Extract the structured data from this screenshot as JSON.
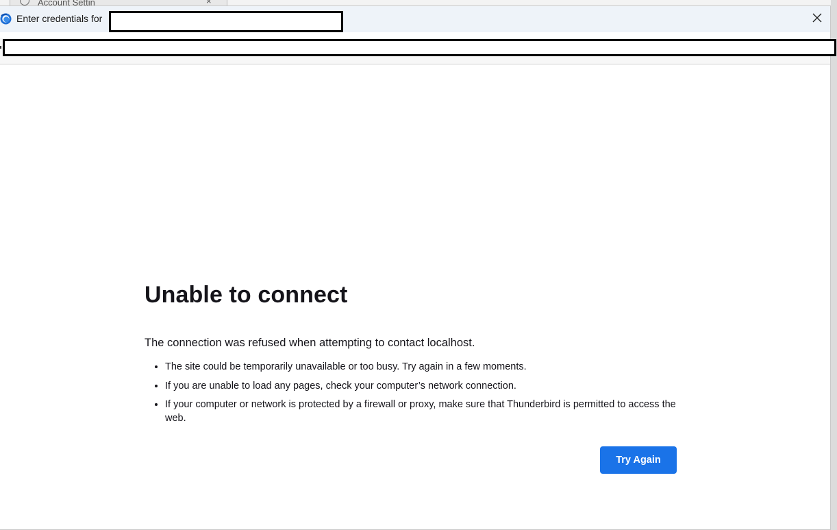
{
  "background_tab": {
    "label": "Account Settin",
    "close_glyph": "×"
  },
  "dialog": {
    "title_prefix": "Enter credentials for",
    "app_icon": "thunderbird-icon",
    "close_icon": "close-icon",
    "title_redacted": true,
    "url_redacted": true
  },
  "error_page": {
    "title": "Unable to connect",
    "description": "The connection was refused when attempting to contact localhost.",
    "bullets": [
      "The site could be temporarily unavailable or too busy. Try again in a few moments.",
      "If you are unable to load any pages, check your computer’s network connection.",
      "If your computer or network is protected by a firewall or proxy, make sure that Thunderbird is permitted to access the web."
    ],
    "try_again_label": "Try Again"
  },
  "colors": {
    "accent": "#1a73e8",
    "titlebar": "#eef3f9",
    "text": "#15141a"
  }
}
